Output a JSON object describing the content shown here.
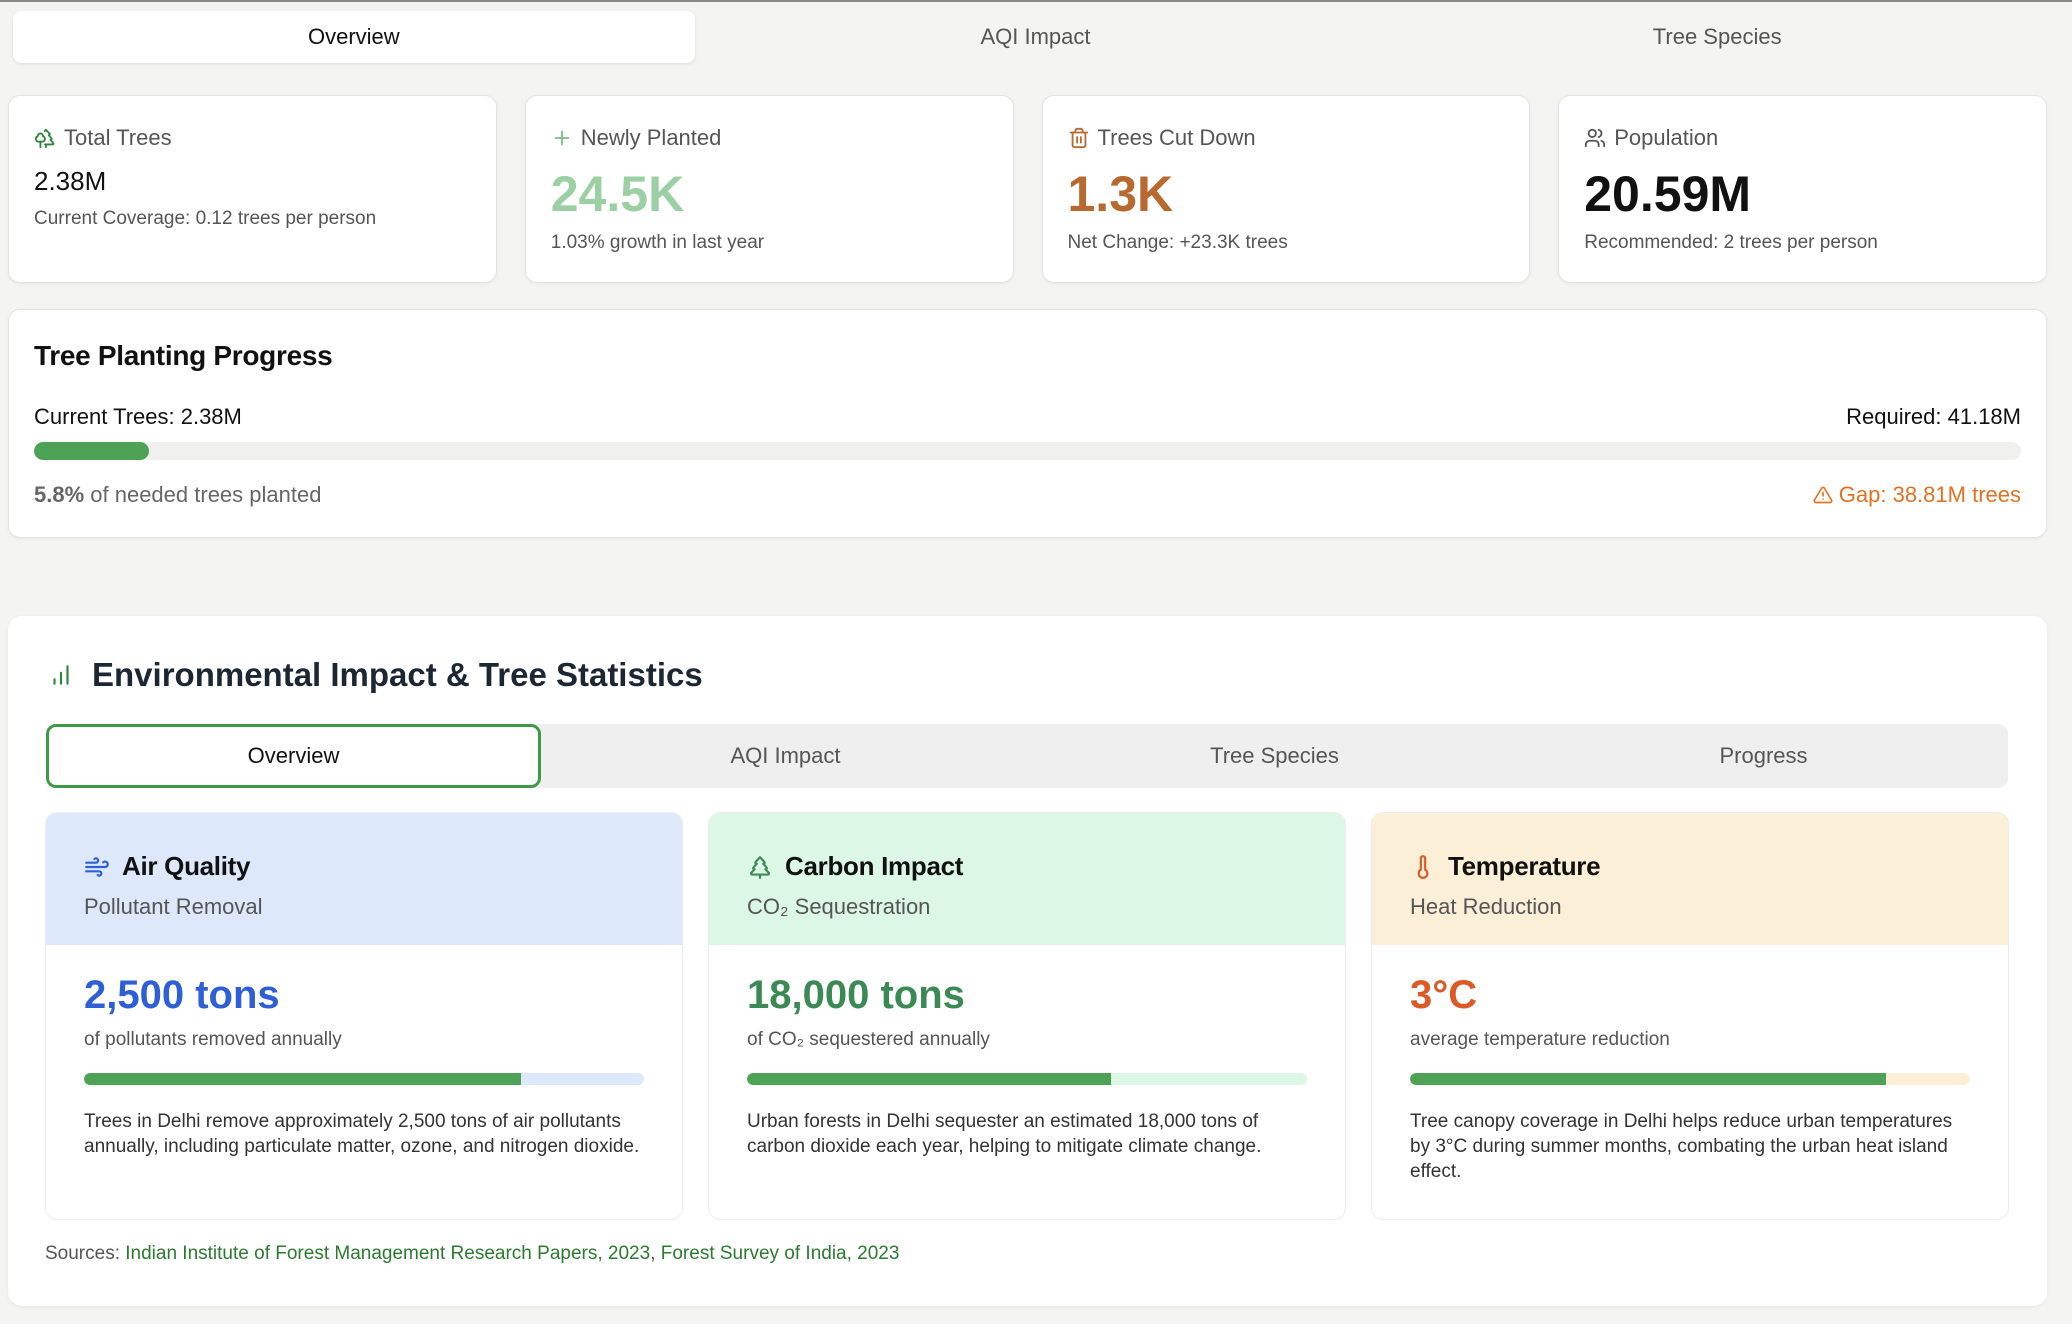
{
  "top_tabs": [
    "Overview",
    "AQI Impact",
    "Tree Species"
  ],
  "stats": [
    {
      "label": "Total Trees",
      "value": "2.38M",
      "sub": "Current Coverage: 0.12 trees per person",
      "icon": "trees-icon"
    },
    {
      "label": "Newly Planted",
      "value": "24.5K",
      "sub": "1.03% growth in last year",
      "icon": "plus-icon",
      "color": "#9ccfa3"
    },
    {
      "label": "Trees Cut Down",
      "value": "1.3K",
      "sub": "Net Change: +23.3K trees",
      "icon": "trash-icon",
      "color": "#b8692f"
    },
    {
      "label": "Population",
      "value": "20.59M",
      "sub": "Recommended: 2 trees per person",
      "icon": "users-icon",
      "color": "#111111"
    }
  ],
  "progress": {
    "title": "Tree Planting Progress",
    "current": "Current Trees: 2.38M",
    "required": "Required: 41.18M",
    "percent_text": "5.8%",
    "percent_suffix": " of needed trees planted",
    "fill_fraction": 0.058,
    "gap": "Gap: 38.81M trees"
  },
  "env": {
    "title": "Environmental Impact & Tree Statistics",
    "tabs": [
      "Overview",
      "AQI Impact",
      "Tree Species",
      "Progress"
    ],
    "cards": [
      {
        "title": "Air Quality",
        "subtitle": "Pollutant Removal",
        "value": "2,500 tons",
        "caption": "of pollutants removed annually",
        "fill_fraction": 0.78,
        "desc": "Trees in Delhi remove approximately 2,500 tons of air pollutants annually, including particulate matter, ozone, and nitrogen dioxide.",
        "icon": "wind-icon",
        "accent": "#2f5fd6",
        "header_bg": "#dde9fb",
        "track": "#dde8fb"
      },
      {
        "title": "Carbon Impact",
        "subtitle": "CO₂ Sequestration",
        "value": "18,000 tons",
        "caption": "of CO₂ sequestered annually",
        "fill_fraction": 0.65,
        "desc": "Urban forests in Delhi sequester an estimated 18,000 tons of carbon dioxide each year, helping to mitigate climate change.",
        "icon": "tree-icon",
        "accent": "#3b8a55",
        "header_bg": "#ddf7e6",
        "track": "#dcf7e5"
      },
      {
        "title": "Temperature",
        "subtitle": "Heat Reduction",
        "value": "3°C",
        "caption": "average temperature reduction",
        "fill_fraction": 0.85,
        "desc": "Tree canopy coverage in Delhi helps reduce urban temperatures by 3°C during summer months, combating the urban heat island effect.",
        "icon": "thermometer-icon",
        "accent": "#dc5a26",
        "header_bg": "#fcefd7",
        "track": "#fbefd8"
      }
    ],
    "sources_label": "Sources: ",
    "sources": [
      "Indian Institute of Forest Management Research Papers, 2023",
      "Forest Survey of India, 2023"
    ]
  }
}
